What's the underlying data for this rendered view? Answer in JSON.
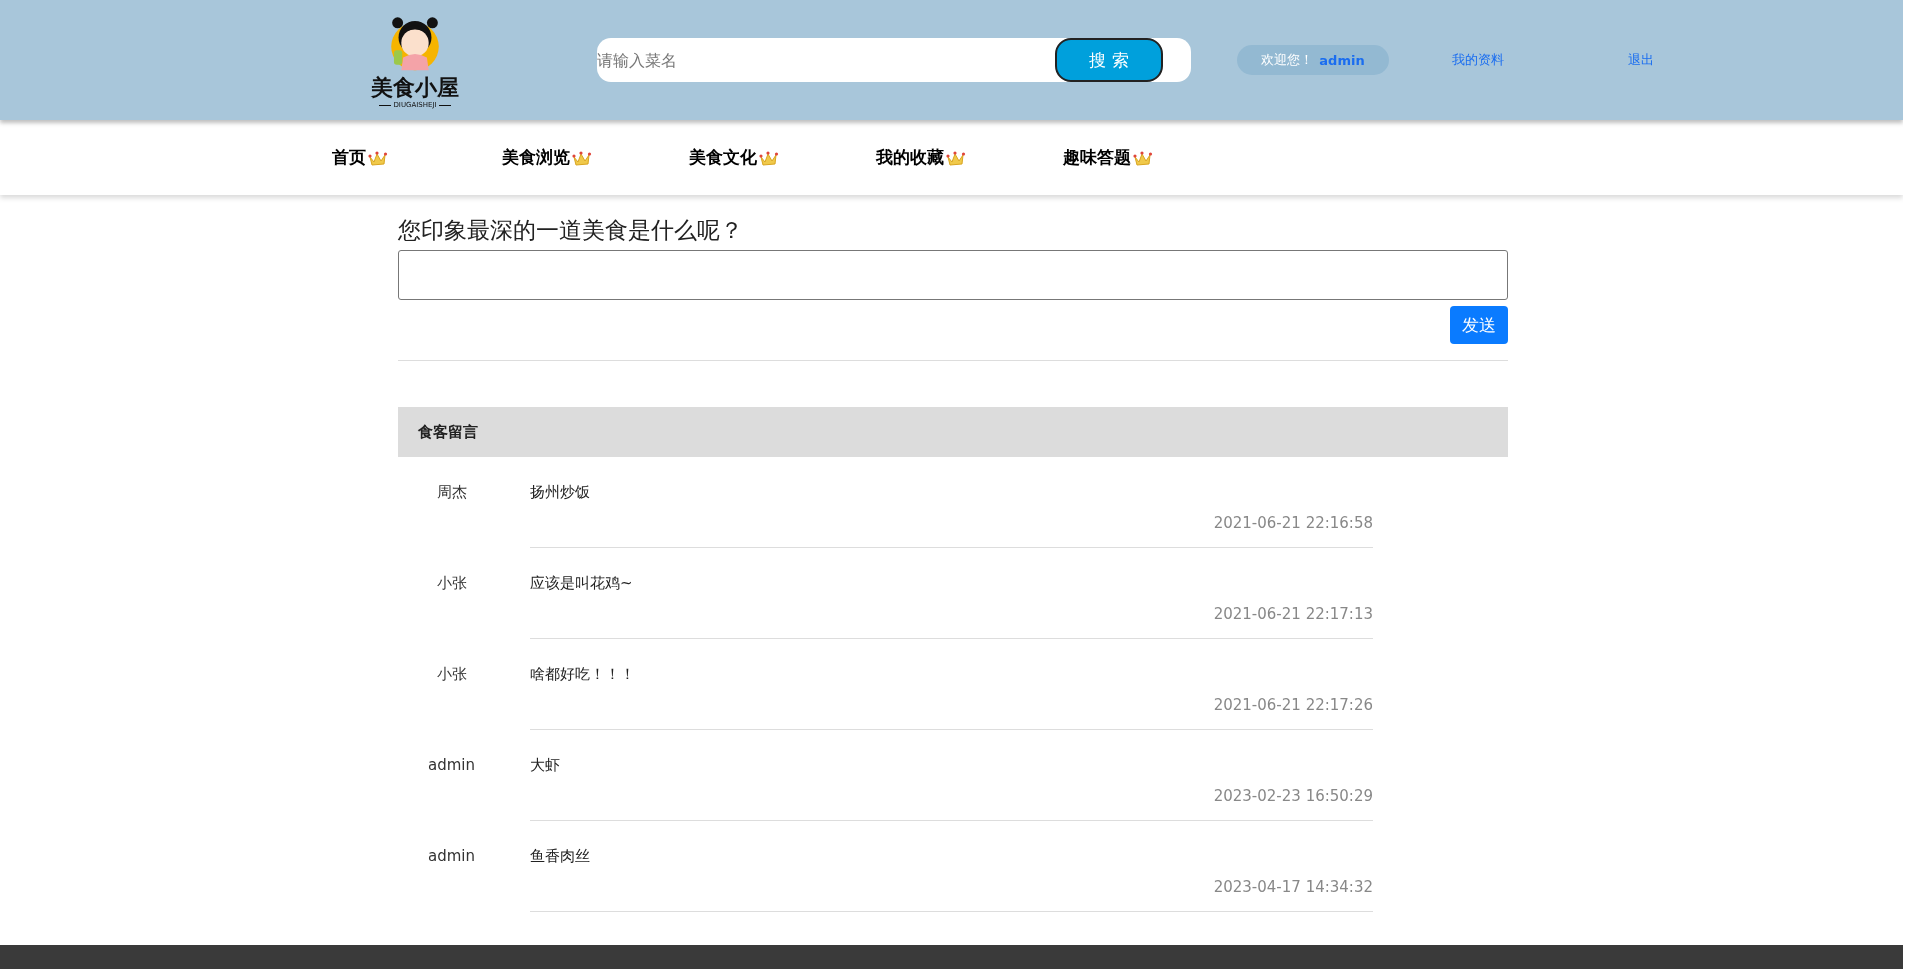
{
  "header": {
    "logo": {
      "title": "美食小屋",
      "subtitle": "DIUGAISHEJI"
    },
    "search": {
      "placeholder": "请输入菜名",
      "button": "搜 索"
    },
    "welcome": {
      "greeting": "欢迎您！",
      "user": "admin"
    },
    "links": [
      "我的资料",
      "退出"
    ]
  },
  "nav": [
    {
      "label": "首页"
    },
    {
      "label": "美食浏览"
    },
    {
      "label": "美食文化"
    },
    {
      "label": "我的收藏"
    },
    {
      "label": "趣味答题"
    }
  ],
  "question": {
    "title": "您印象最深的一道美食是什么呢？",
    "button": "发送"
  },
  "comments": {
    "title": "食客留言",
    "rows": [
      {
        "name": "周杰",
        "text": "扬州炒饭",
        "time": "2021-06-21 22:16:58"
      },
      {
        "name": "小张",
        "text": "应该是叫花鸡~",
        "time": "2021-06-21 22:17:13"
      },
      {
        "name": "小张",
        "text": "啥都好吃！！！",
        "time": "2021-06-21 22:17:26"
      },
      {
        "name": "admin",
        "text": "大虾",
        "time": "2023-02-23 16:50:29"
      },
      {
        "name": "admin",
        "text": "鱼香肉丝",
        "time": "2023-04-17 14:34:32"
      }
    ]
  }
}
